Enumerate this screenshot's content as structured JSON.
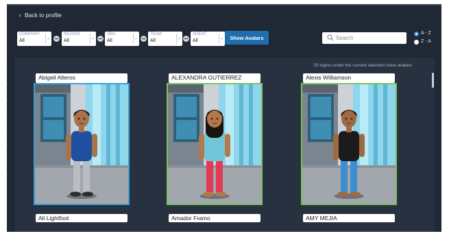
{
  "header": {
    "back_label": "Back to profile"
  },
  "filters": [
    {
      "label": "COMPANY",
      "value": "All"
    },
    {
      "label": "REGION",
      "value": "All"
    },
    {
      "label": "SBU",
      "value": "All"
    },
    {
      "label": "TEAM",
      "value": "All"
    },
    {
      "label": "AGENT",
      "value": "All"
    }
  ],
  "show_button": "Show Avatars",
  "search": {
    "placeholder": "Search"
  },
  "sort": [
    {
      "label": "A - Z",
      "selected": true
    },
    {
      "label": "Z - A",
      "selected": false
    }
  ],
  "count_text": "33 logins under the current selection have avatars",
  "avatars": [
    {
      "name": "Abigeil Alteros",
      "border": "#3aa0d8",
      "skin": "#a8734a",
      "hair": "#1c1512",
      "shirt": "#1f4f9f",
      "pants": "#b9bec4",
      "shoes": "#2b2b2b",
      "hair_long": false
    },
    {
      "name": "ALEXANDRA GUTIERREZ",
      "border": "#7fc35a",
      "skin": "#b27a4c",
      "hair": "#1a1411",
      "shirt": "#6fc6d6",
      "pants": "#e23a55",
      "shoes": "#b27a4c",
      "hair_long": true
    },
    {
      "name": "Alexis Williamson",
      "border": "#7fc35a",
      "skin": "#a06a40",
      "hair": "#2a1a12",
      "shirt": "#1b1b1b",
      "pants": "#3b8fd0",
      "shoes": "#a06a40",
      "hair_long": false
    }
  ],
  "next_row": [
    "Ali Lightfoot",
    "Amador Framo",
    "AMY MEJIA"
  ]
}
